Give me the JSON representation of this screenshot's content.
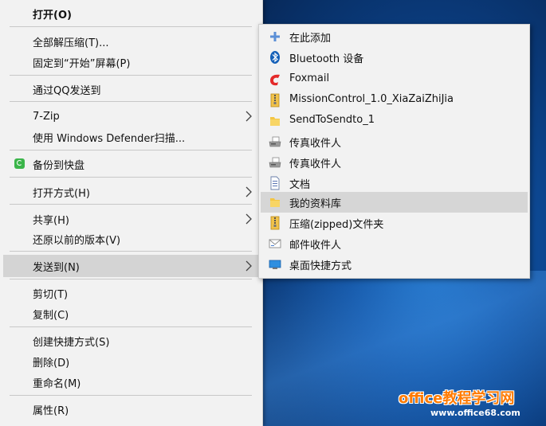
{
  "context_menu": {
    "items": [
      {
        "label": "打开(O)"
      },
      {
        "label": "全部解压缩(T)..."
      },
      {
        "label": "固定到“开始”屏幕(P)"
      },
      {
        "label": "通过QQ发送到"
      },
      {
        "label": "7-Zip"
      },
      {
        "label": "使用 Windows Defender扫描..."
      },
      {
        "label": "备份到快盘"
      },
      {
        "label": "打开方式(H)"
      },
      {
        "label": "共享(H)"
      },
      {
        "label": "还原以前的版本(V)"
      },
      {
        "label": "发送到(N)"
      },
      {
        "label": "剪切(T)"
      },
      {
        "label": "复制(C)"
      },
      {
        "label": "创建快捷方式(S)"
      },
      {
        "label": "删除(D)"
      },
      {
        "label": "重命名(M)"
      },
      {
        "label": "属性(R)"
      }
    ]
  },
  "send_to_menu": {
    "items": [
      {
        "label": "在此添加",
        "icon": "plus-icon"
      },
      {
        "label": "Bluetooth 设备",
        "icon": "bluetooth-icon"
      },
      {
        "label": "Foxmail",
        "icon": "foxmail-icon"
      },
      {
        "label": "MissionControl_1.0_XiaZaiZhiJia",
        "icon": "zip-folder-icon"
      },
      {
        "label": "SendToSendto_1",
        "icon": "folder-icon"
      },
      {
        "label": "传真收件人",
        "icon": "fax-icon"
      },
      {
        "label": "传真收件人",
        "icon": "fax-icon"
      },
      {
        "label": "文档",
        "icon": "document-icon"
      },
      {
        "label": "我的资料库",
        "icon": "folder-icon"
      },
      {
        "label": "压缩(zipped)文件夹",
        "icon": "zip-folder-icon"
      },
      {
        "label": "邮件收件人",
        "icon": "mail-icon"
      },
      {
        "label": "桌面快捷方式",
        "icon": "desktop-icon"
      }
    ]
  },
  "watermark": {
    "line1": "office教程学习网",
    "line2": "www.office68.com"
  }
}
